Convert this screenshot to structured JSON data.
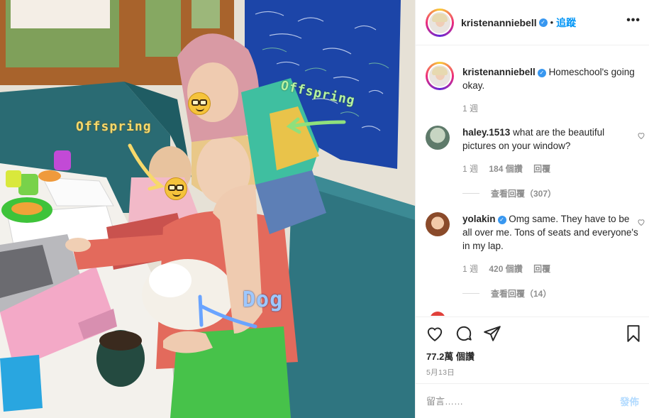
{
  "photo": {
    "stickers": {
      "offspring_left": "Offspring",
      "offspring_right": "Offspring",
      "dog": "Dog"
    },
    "colors": {
      "yellow": "#f7d96b",
      "green": "#b6f2a2",
      "blue": "#9ec8ff"
    }
  },
  "header": {
    "username": "kristenanniebell",
    "separator": "•",
    "follow_label": "追蹤",
    "more_icon": "more-options-icon",
    "more_glyph": "•••",
    "verified_glyph": "✓"
  },
  "caption": {
    "username": "kristenanniebell",
    "text": "Homeschool's going okay.",
    "time": "1 週"
  },
  "comments": [
    {
      "username": "haley.1513",
      "text": "what are the beautiful pictures on your window?",
      "time": "1 週",
      "likes": "184 個讚",
      "reply_label": "回覆",
      "view_replies": "查看回覆（307）",
      "verified": false
    },
    {
      "username": "yolakin",
      "text": "Omg same. They have to be all over me. Tons of seats and everyone's in my lap.",
      "time": "1 週",
      "likes": "420 個讚",
      "reply_label": "回覆",
      "view_replies": "查看回覆（14）",
      "verified": true
    }
  ],
  "actions": {
    "like_icon": "heart-icon",
    "comment_icon": "comment-icon",
    "share_icon": "share-icon",
    "save_icon": "bookmark-icon",
    "likes_count": "77.2萬 個讚",
    "date": "5月13日"
  },
  "comment_box": {
    "placeholder": "留言……",
    "post_label": "發佈"
  },
  "theme": {
    "link_blue": "#0095f6",
    "muted": "#8e8e8e",
    "border": "#efefef",
    "verified": "#3897f0"
  }
}
